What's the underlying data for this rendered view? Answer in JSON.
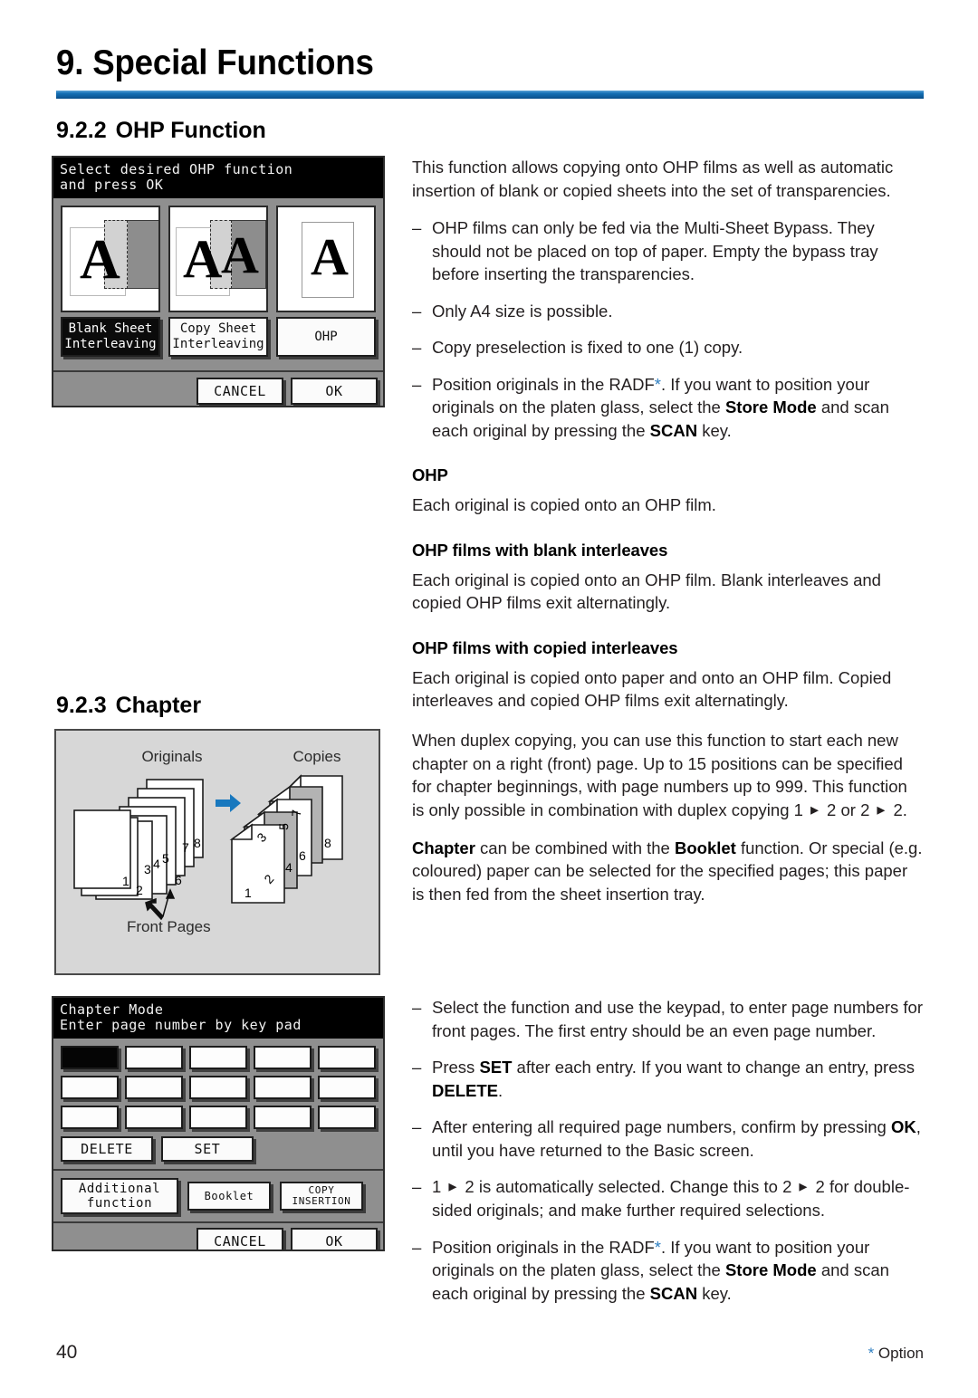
{
  "header": {
    "chapter_title": "9. Special Functions",
    "rule_color": "#1570b4"
  },
  "sections": {
    "ohp": {
      "number": "9.2.2",
      "title": "OHP Function"
    },
    "chapter": {
      "number": "9.2.3",
      "title": "Chapter"
    }
  },
  "ohp_panel": {
    "header_line1": "Select desired OHP function",
    "header_line2": "and press OK",
    "cards": [
      {
        "label_line1": "Blank Sheet",
        "label_line2": "Interleaving",
        "selected": true
      },
      {
        "label_line1": "Copy Sheet",
        "label_line2": "Interleaving",
        "selected": false
      },
      {
        "label_line1": "OHP",
        "label_line2": "",
        "selected": false
      }
    ],
    "cancel_label": "CANCEL",
    "ok_label": "OK"
  },
  "chapter_panel": {
    "header_line1": "Chapter Mode",
    "header_line2": "Enter page number by key pad",
    "keypad_cells": 15,
    "active_cell_index": 0,
    "delete_label": "DELETE",
    "set_label": "SET",
    "additional_function_line1": "Additional",
    "additional_function_line2": "function",
    "booklet_label": "Booklet",
    "copy_insertion_line1": "COPY",
    "copy_insertion_line2": "INSERTION",
    "cancel_label": "CANCEL",
    "ok_label": "OK"
  },
  "diagram": {
    "originals_label": "Originals",
    "copies_label": "Copies",
    "front_pages_label": "Front Pages",
    "originals_numbers": [
      "1",
      "2",
      "3",
      "4",
      "5",
      "6",
      "7",
      "8"
    ],
    "copies_numbers": [
      "1",
      "2",
      "3",
      "4",
      "5",
      "6",
      "7",
      "8"
    ],
    "arrow_color": "#1878be"
  },
  "ohp_text": {
    "intro": "This function allows copying onto OHP films as well as automatic insertion of blank or copied sheets into the set of transparencies.",
    "bullets": [
      "OHP films can only be fed via the Multi-Sheet Bypass. They should not be placed on top of paper. Empty the bypass tray before inserting the transparencies.",
      "Only A4 size is possible.",
      "Copy preselection is fixed to one (1) copy."
    ],
    "radf_bullet_a": "Position originals in the RADF",
    "radf_bullet_b": ". If you want to position your originals on the platen glass, select the ",
    "radf_bold1": "Store Mode",
    "radf_bullet_c": " and scan each original by pressing the ",
    "radf_bold2": "SCAN",
    "radf_bullet_d": " key.",
    "head_ohp": "OHP",
    "body_ohp": "Each original is copied onto an OHP film.",
    "head_blank": "OHP films with blank interleaves",
    "body_blank": "Each original is copied onto an OHP film. Blank interleaves and copied OHP films exit alternatingly.",
    "head_copied": "OHP films with copied interleaves",
    "body_copied": "Each original is copied onto paper and onto an OHP film. Copied interleaves and copied OHP films exit alternatingly."
  },
  "chapter_text": {
    "p1_a": "When duplex copying, you can use this function to start each new chapter on a right (front) page. Up to 15 positions can be specified for chapter beginnings, with page numbers up to 999. This function is only possible in combination with duplex copying 1 ",
    "p1_b": " 2 or 2 ",
    "p1_c": " 2.",
    "p2_bold1": "Chapter",
    "p2_a": " can be combined with the ",
    "p2_bold2": "Booklet",
    "p2_b": " function. Or special (e.g. coloured) paper can be selected for the specified pages; this paper is then fed from the sheet insertion tray.",
    "b1": "Select the function and use the keypad, to enter page numbers for front pages. The first entry should be an even page number.",
    "b2_a": "Press ",
    "b2_bold1": "SET",
    "b2_b": " after each entry. If you want to change an entry, press ",
    "b2_bold2": "DELETE",
    "b2_c": ".",
    "b3_a": "After entering all required page numbers, confirm by pressing ",
    "b3_bold": "OK",
    "b3_b": ", until you have returned to the Basic screen.",
    "b4_a": "1 ",
    "b4_b": " 2 is automatically selected. Change this to 2 ",
    "b4_c": " 2 for double-sided originals; and make further required selections.",
    "b5_a": "Position originals in the RADF",
    "b5_b": ". If you want to position your originals on the platen glass, select the ",
    "b5_bold1": "Store Mode",
    "b5_c": " and scan each original by pressing the ",
    "b5_bold2": "SCAN",
    "b5_d": " key."
  },
  "footer": {
    "page_number": "40",
    "option_star": "*",
    "option_label": " Option"
  }
}
